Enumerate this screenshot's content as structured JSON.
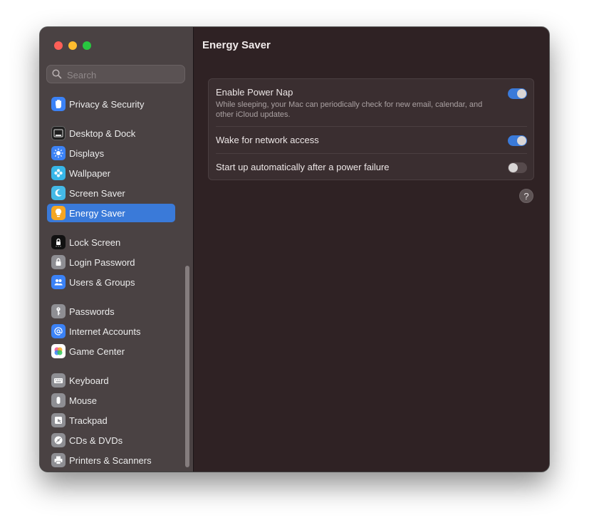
{
  "window": {
    "title": "Energy Saver"
  },
  "search": {
    "placeholder": "Search"
  },
  "sidebar": {
    "items": [
      {
        "label": "Privacy & Security",
        "icon": "hand-icon",
        "color": "#3b82f6"
      },
      {
        "label": "Desktop & Dock",
        "icon": "dock-icon",
        "color": "#1f1f1f"
      },
      {
        "label": "Displays",
        "icon": "sun-icon",
        "color": "#3b82f6"
      },
      {
        "label": "Wallpaper",
        "icon": "flower-icon",
        "color": "#37b6e8"
      },
      {
        "label": "Screen Saver",
        "icon": "moon-icon",
        "color": "#44b9e6"
      },
      {
        "label": "Energy Saver",
        "icon": "lightbulb-icon",
        "color": "#f5a623",
        "selected": true
      },
      {
        "label": "Lock Screen",
        "icon": "lock-icon",
        "color": "#111111"
      },
      {
        "label": "Login Password",
        "icon": "padlock-icon",
        "color": "#8e8e93"
      },
      {
        "label": "Users & Groups",
        "icon": "users-icon",
        "color": "#3b82f6"
      },
      {
        "label": "Passwords",
        "icon": "key-icon",
        "color": "#8e8e93"
      },
      {
        "label": "Internet Accounts",
        "icon": "at-icon",
        "color": "#3b82f6"
      },
      {
        "label": "Game Center",
        "icon": "game-center-icon",
        "color": "#ffffff"
      },
      {
        "label": "Keyboard",
        "icon": "keyboard-icon",
        "color": "#8e8e93"
      },
      {
        "label": "Mouse",
        "icon": "mouse-icon",
        "color": "#8e8e93"
      },
      {
        "label": "Trackpad",
        "icon": "trackpad-icon",
        "color": "#8e8e93"
      },
      {
        "label": "CDs & DVDs",
        "icon": "disc-icon",
        "color": "#8e8e93"
      },
      {
        "label": "Printers & Scanners",
        "icon": "printer-icon",
        "color": "#8e8e93"
      }
    ]
  },
  "settings": [
    {
      "label": "Enable Power Nap",
      "description": "While sleeping, your Mac can periodically check for new email, calendar, and other iCloud updates.",
      "enabled": true
    },
    {
      "label": "Wake for network access",
      "enabled": true
    },
    {
      "label": "Start up automatically after a power failure",
      "enabled": false
    }
  ],
  "help": {
    "label": "?"
  },
  "colors": {
    "accent": "#3a7ad9",
    "sidebar_bg": "#4a4243",
    "content_bg": "#2f2224"
  }
}
